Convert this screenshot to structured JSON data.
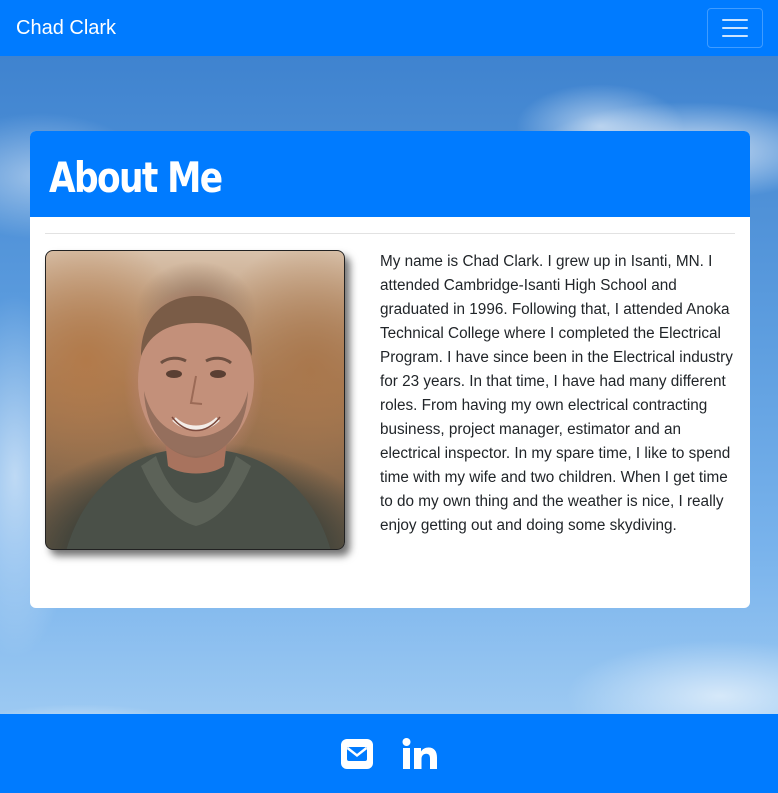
{
  "navbar": {
    "brand": "Chad Clark",
    "toggle_icon": "hamburger-menu-icon"
  },
  "about": {
    "title": "About Me",
    "photo_alt": "Chad Clark portrait",
    "bio": "My name is Chad Clark. I grew up in Isanti, MN. I attended Cambridge-Isanti High School and graduated in 1996. Following that, I attended Anoka Technical College where I completed the Electrical Program. I have since been in the Electrical industry for 23 years. In that time, I have had many different roles. From having my own electrical contracting business, project manager, estimator and an electrical inspector. In my spare time, I like to spend time with my wife and two children. When I get time to do my own thing and the weather is nice, I really enjoy getting out and doing some skydiving."
  },
  "footer": {
    "links": [
      {
        "icon": "envelope-icon"
      },
      {
        "icon": "linkedin-icon"
      }
    ]
  },
  "colors": {
    "primary": "#007bff",
    "text": "#212529"
  }
}
